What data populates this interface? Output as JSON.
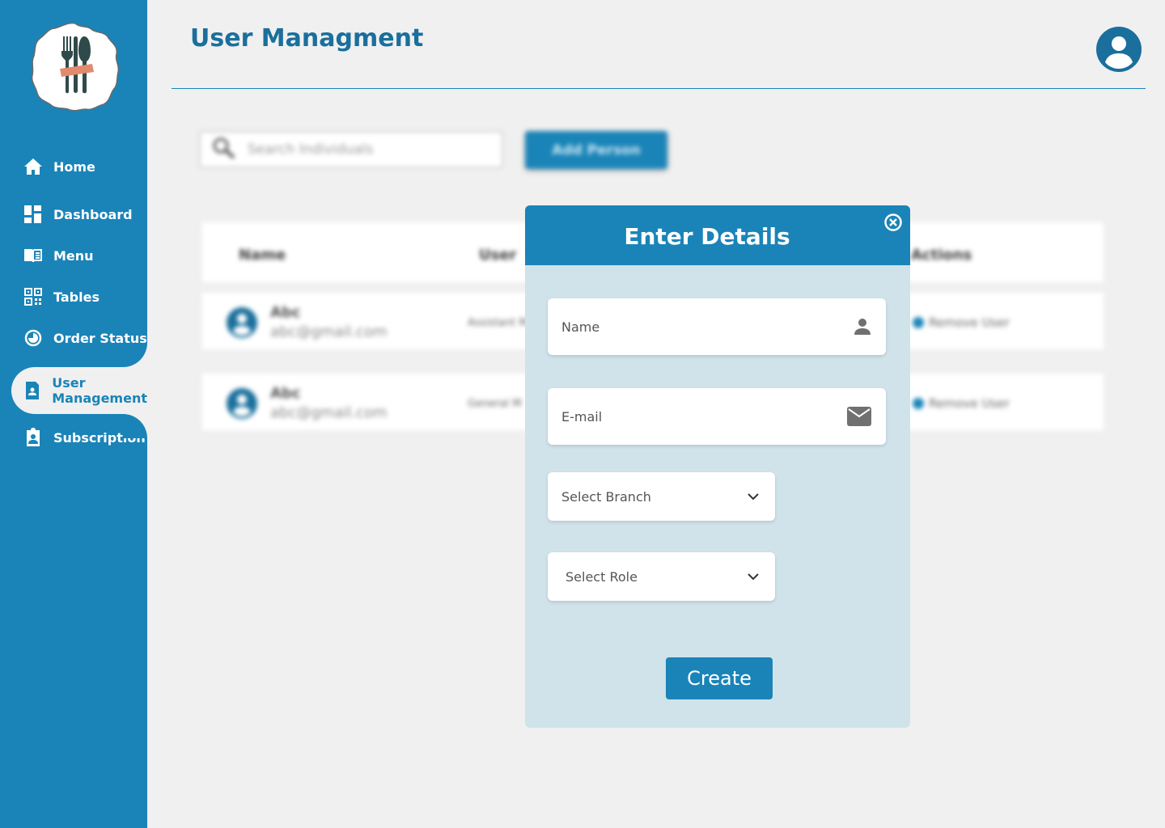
{
  "sidebar": {
    "items": [
      {
        "label": "Home",
        "icon": "home-icon"
      },
      {
        "label": "Dashboard",
        "icon": "dashboard-icon"
      },
      {
        "label": "Menu",
        "icon": "book-icon"
      },
      {
        "label": "Tables",
        "icon": "qr-icon"
      },
      {
        "label": "Order Status",
        "icon": "pie-icon"
      },
      {
        "label_line1": "User",
        "label_line2": "Management",
        "icon": "user-badge-icon",
        "active": true
      },
      {
        "label": "Subscription",
        "icon": "clipboard-user-icon"
      }
    ]
  },
  "header": {
    "title": "User Managment"
  },
  "background": {
    "search_placeholder": "Search Individuals",
    "add_button": "Add Person",
    "table": {
      "columns": [
        "Name",
        "User",
        "Actions"
      ],
      "rows": [
        {
          "name": "Abc",
          "email": "abc@gmail.com",
          "role": "Assistant M",
          "action": "Remove User"
        },
        {
          "name": "Abc",
          "email": "abc@gmail.com",
          "role": "General M",
          "action": "Remove User"
        }
      ]
    }
  },
  "modal": {
    "title": "Enter Details",
    "name_label": "Name",
    "email_label": "E-mail",
    "branch_label": "Select Branch",
    "role_label": "Select Role",
    "create_label": "Create"
  },
  "colors": {
    "primary": "#1a84b8",
    "title": "#1a6f9c",
    "modal_body": "#d0e2ea",
    "page_bg": "#f0f0f0"
  }
}
